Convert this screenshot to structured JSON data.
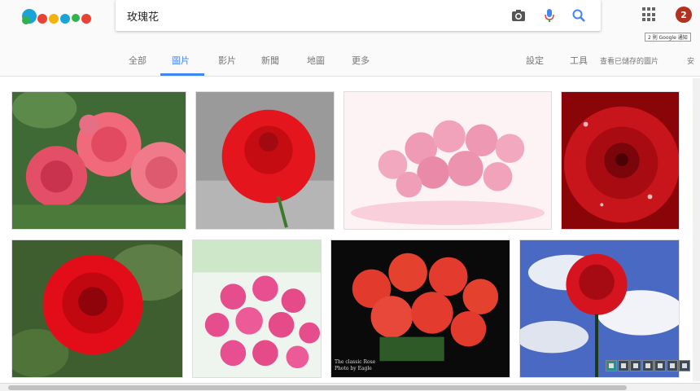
{
  "header": {
    "logo_label": "Google",
    "search": {
      "value": "玫瑰花",
      "placeholder": ""
    },
    "notification_count": "2",
    "tooltip": "2 則 Google 通知",
    "icons": [
      "camera-icon",
      "microphone-icon",
      "search-icon",
      "apps-grid-icon"
    ]
  },
  "tabs": {
    "all": "全部",
    "images": "圖片",
    "videos": "影片",
    "news": "新聞",
    "maps": "地圖",
    "more": "更多",
    "settings": "設定",
    "tools": "工具",
    "saved": "查看已儲存的圖片",
    "safe": "安"
  },
  "results": {
    "caption_line1": "The classic Rose",
    "caption_line2": "Photo by Eagle"
  },
  "colors": {
    "accent": "#4285f4",
    "notification": "#b3321f"
  }
}
